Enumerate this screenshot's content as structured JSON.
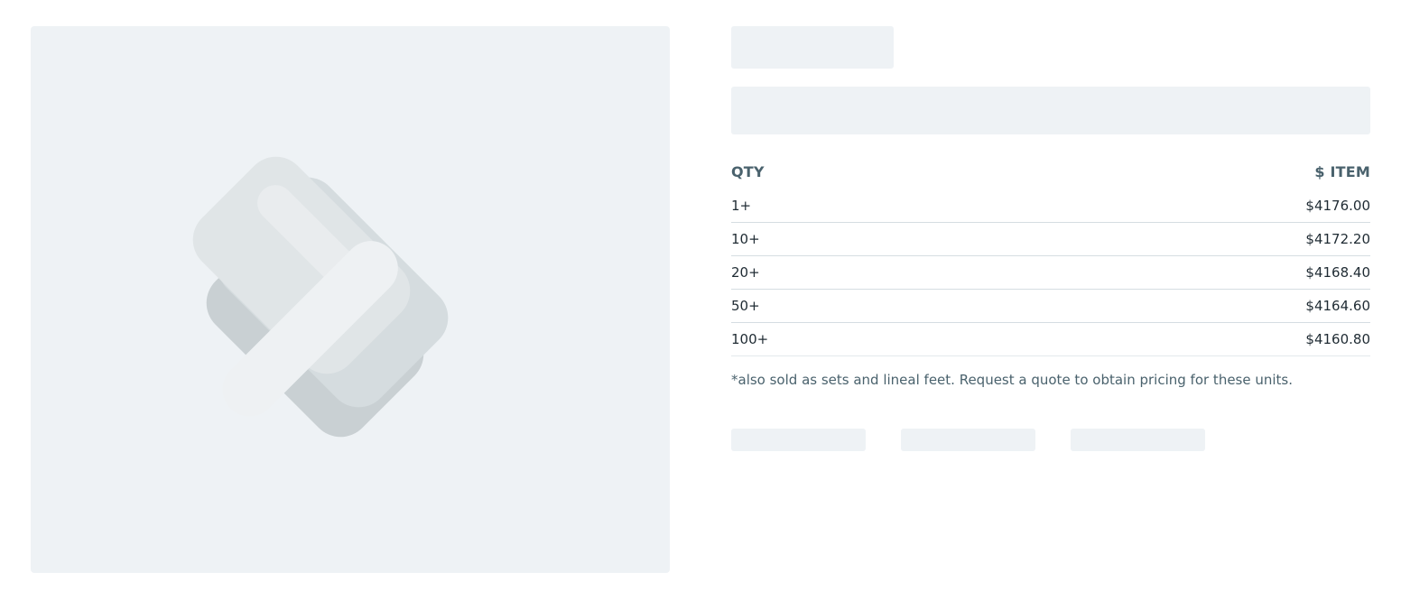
{
  "product": {
    "image_icon": "image-placeholder-icon"
  },
  "pricing": {
    "header": {
      "qty_label": "QTY",
      "price_label": "$ ITEM"
    },
    "rows": [
      {
        "qty": "1+",
        "price": "$4176.00"
      },
      {
        "qty": "10+",
        "price": "$4172.20"
      },
      {
        "qty": "20+",
        "price": "$4168.40"
      },
      {
        "qty": "50+",
        "price": "$4164.60"
      },
      {
        "qty": "100+",
        "price": "$4160.80"
      }
    ],
    "note": "*also sold as sets and lineal feet. Request a quote to obtain pricing for these units."
  },
  "colors": {
    "skeleton": "#eef2f5",
    "header_text": "#4a626d",
    "row_text": "#1f2b33",
    "divider": "#d5dde2"
  }
}
